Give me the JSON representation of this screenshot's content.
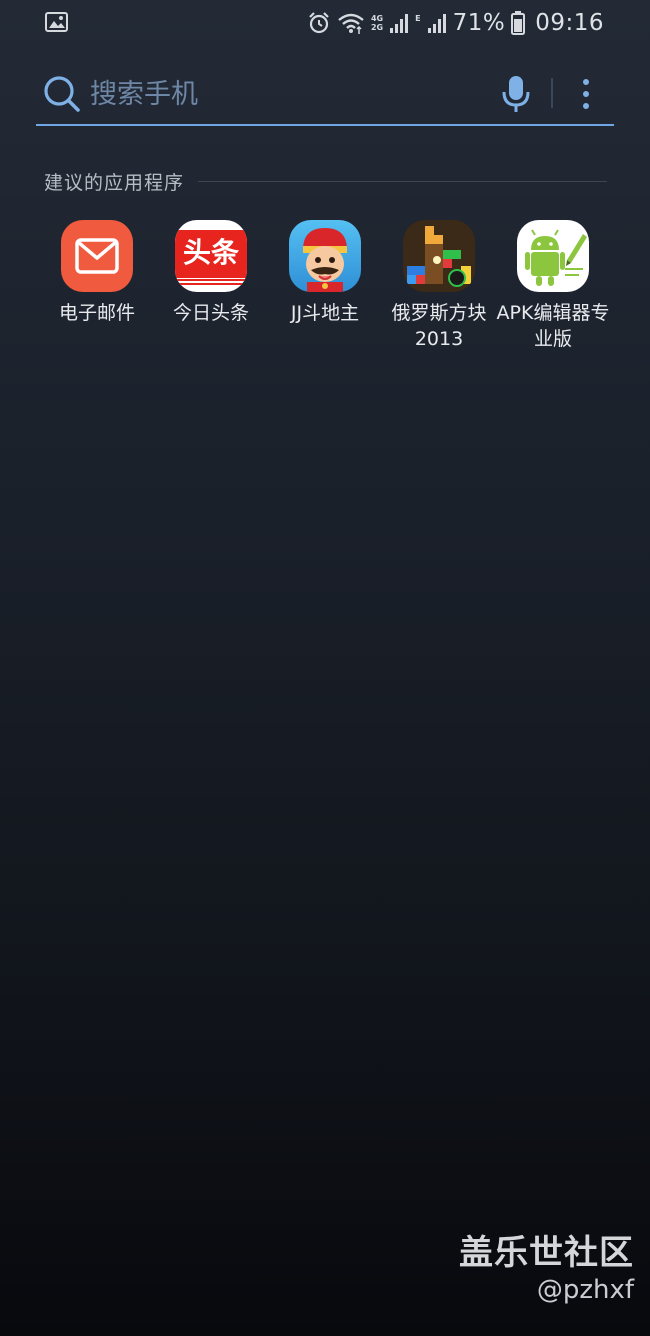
{
  "status_bar": {
    "left_icon": "gallery-icon",
    "icons": [
      "alarm-icon",
      "wifi-icon",
      "signal-icon",
      "signal-icon-2",
      "battery-icon"
    ],
    "network_tags": [
      "4G",
      "2G",
      "E"
    ],
    "battery_percent": "71%",
    "time": "09:16"
  },
  "search": {
    "placeholder": "搜索手机",
    "value": "",
    "icons": [
      "search-icon",
      "microphone-icon",
      "more-options-icon"
    ],
    "accent_color": "#6fa6e3"
  },
  "suggested_apps": {
    "title": "建议的应用程序",
    "apps": [
      {
        "name": "电子邮件",
        "icon": "email-icon",
        "color": "#f05a3e"
      },
      {
        "name": "今日头条",
        "icon": "toutiao-icon",
        "color": "#e8241f",
        "icon_text": "头条"
      },
      {
        "name": "JJ斗地主",
        "icon": "jj-doudizhu-icon",
        "color": "#3ea9e8"
      },
      {
        "name": "俄罗斯方块 2013",
        "icon": "tetris-icon",
        "color": "#2a1f14"
      },
      {
        "name": "APK编辑器专业版",
        "icon": "apk-editor-icon",
        "color": "#8cc63f"
      }
    ]
  },
  "watermark": {
    "brand": "盖乐世社区",
    "handle": "@pzhxf"
  }
}
